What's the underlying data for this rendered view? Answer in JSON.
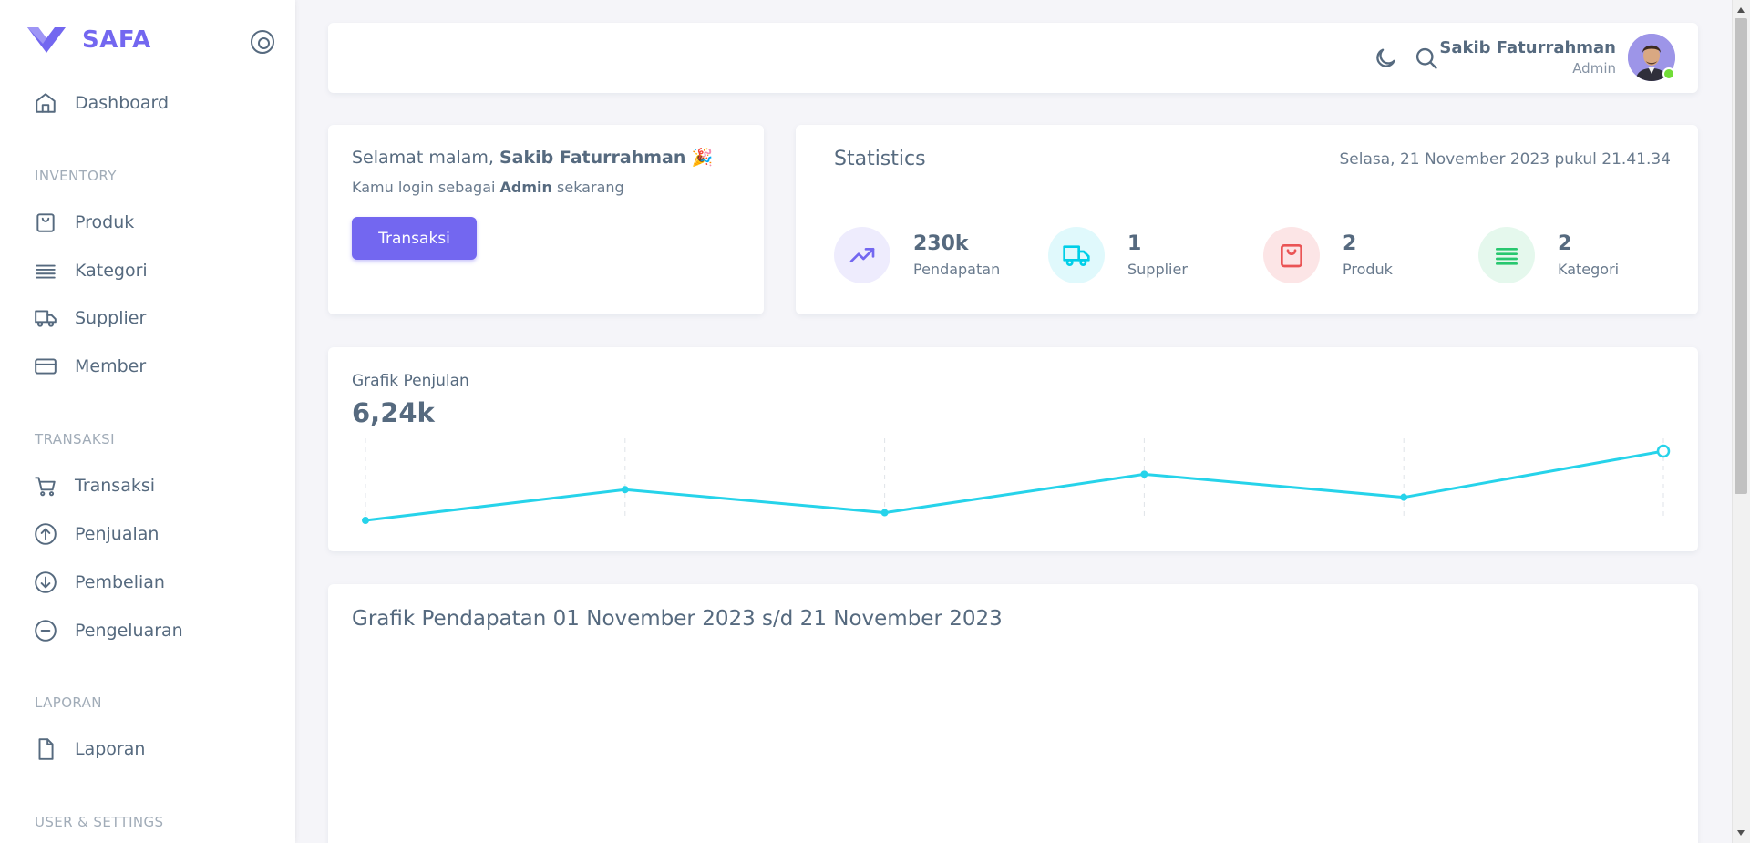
{
  "brand": {
    "name": "SAFA",
    "color": "#7367f0"
  },
  "sidebar": {
    "items": [
      {
        "label": "Dashboard",
        "icon": "home-icon"
      },
      {
        "label": "Produk",
        "icon": "shopping-bag-icon"
      },
      {
        "label": "Kategori",
        "icon": "list-icon"
      },
      {
        "label": "Supplier",
        "icon": "truck-icon"
      },
      {
        "label": "Member",
        "icon": "card-icon"
      },
      {
        "label": "Transaksi",
        "icon": "cart-icon"
      },
      {
        "label": "Penjualan",
        "icon": "arrow-up-circle-icon"
      },
      {
        "label": "Pembelian",
        "icon": "arrow-down-circle-icon"
      },
      {
        "label": "Pengeluaran",
        "icon": "minus-circle-icon"
      },
      {
        "label": "Laporan",
        "icon": "file-icon"
      }
    ],
    "headers": [
      "INVENTORY",
      "TRANSAKSI",
      "LAPORAN",
      "USER & SETTINGS"
    ]
  },
  "navbar": {
    "user_name": "Sakib Faturrahman",
    "user_role": "Admin",
    "icons": [
      "moon-icon",
      "search-icon"
    ]
  },
  "welcome": {
    "greeting": "Selamat malam,",
    "name": "Sakib Faturrahman",
    "emoji": "🎉",
    "sub_prefix": "Kamu login sebagai",
    "sub_role": "Admin",
    "sub_suffix": "sekarang",
    "button_label": "Transaksi"
  },
  "statistics": {
    "title": "Statistics",
    "date": "Selasa, 21 November 2023 pukul 21.41.34",
    "items": [
      {
        "value": "230k",
        "label": "Pendapatan",
        "icon": "trending-up-icon",
        "color": "#7367f0",
        "bg": "#eeecfd"
      },
      {
        "value": "1",
        "label": "Supplier",
        "icon": "truck-icon",
        "color": "#00cfe8",
        "bg": "#e0f9fc"
      },
      {
        "value": "2",
        "label": "Produk",
        "icon": "shopping-bag-icon",
        "color": "#ea5455",
        "bg": "#fce5e6"
      },
      {
        "value": "2",
        "label": "Kategori",
        "icon": "list-icon",
        "color": "#28c76f",
        "bg": "#e5f8ed"
      }
    ]
  },
  "sales": {
    "title": "Grafik Penjulan",
    "value": "6,24k",
    "line_color": "#26d3ea"
  },
  "chart_data": {
    "type": "line",
    "title": "Grafik Penjulan",
    "series": [
      {
        "values": [
          0,
          4,
          1,
          6,
          3,
          9
        ]
      }
    ],
    "ylim": [
      0,
      9
    ],
    "grid": "vertical dashed"
  },
  "revenue": {
    "title": "Grafik Pendapatan 01 November 2023 s/d 21 November 2023"
  }
}
